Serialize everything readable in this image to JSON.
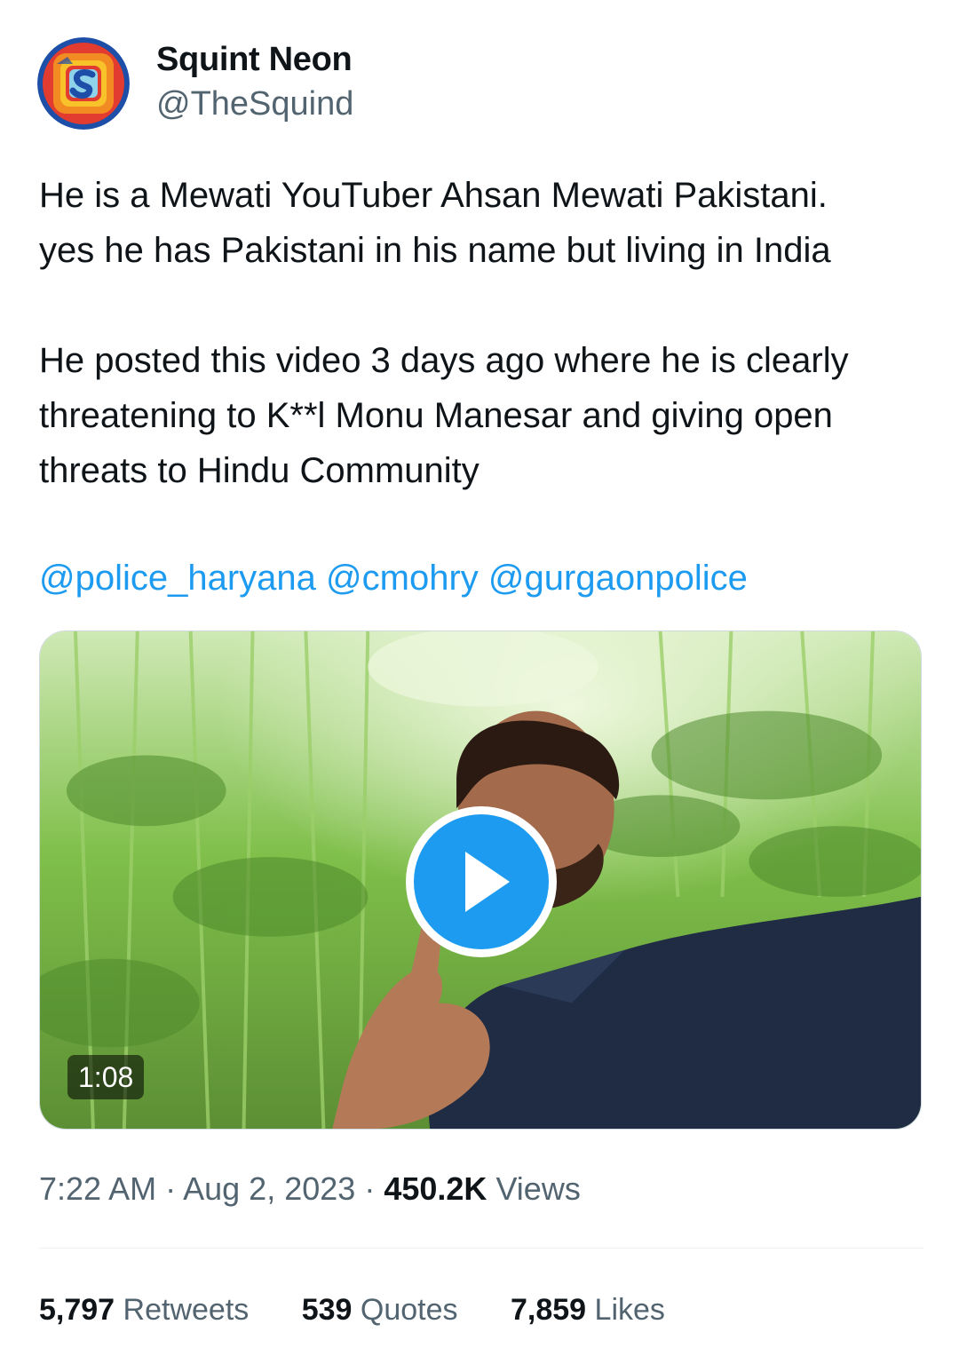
{
  "author": {
    "name": "Squint Neon",
    "handle": "@TheSquind"
  },
  "tweet": {
    "paragraph1_line1": "He is a Mewati YouTuber Ahsan Mewati Pakistani.",
    "paragraph1_line2": "yes he has Pakistani in his name but living in India",
    "paragraph2_line1": "He posted this video 3 days ago where he is clearly",
    "paragraph2_line2": "threatening to K**l Monu Manesar and giving open",
    "paragraph2_line3": "threats to Hindu Community",
    "mentions": [
      "@police_haryana",
      "@cmohry",
      "@gurgaonpolice"
    ]
  },
  "media": {
    "duration": "1:08",
    "play_icon": "play-icon"
  },
  "meta": {
    "time": "7:22 AM",
    "separator": "·",
    "date": "Aug 2, 2023",
    "views_count": "450.2K",
    "views_label": "Views"
  },
  "stats": {
    "retweets_count": "5,797",
    "retweets_label": "Retweets",
    "quotes_count": "539",
    "quotes_label": "Quotes",
    "likes_count": "7,859",
    "likes_label": "Likes"
  },
  "colors": {
    "link": "#1d9bf0",
    "secondary_text": "#536471",
    "primary_text": "#0f1419",
    "play_button": "#1d9bf0"
  }
}
